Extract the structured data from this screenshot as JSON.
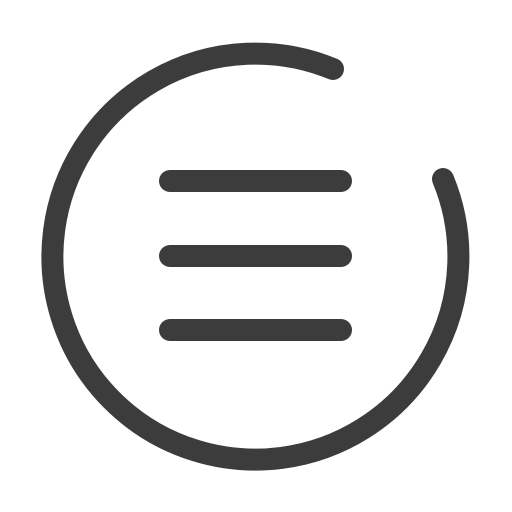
{
  "icon": {
    "name": "circled-hamburger-menu-icon",
    "stroke_color": "#3c3c3c",
    "background_color": "#ffffff"
  }
}
